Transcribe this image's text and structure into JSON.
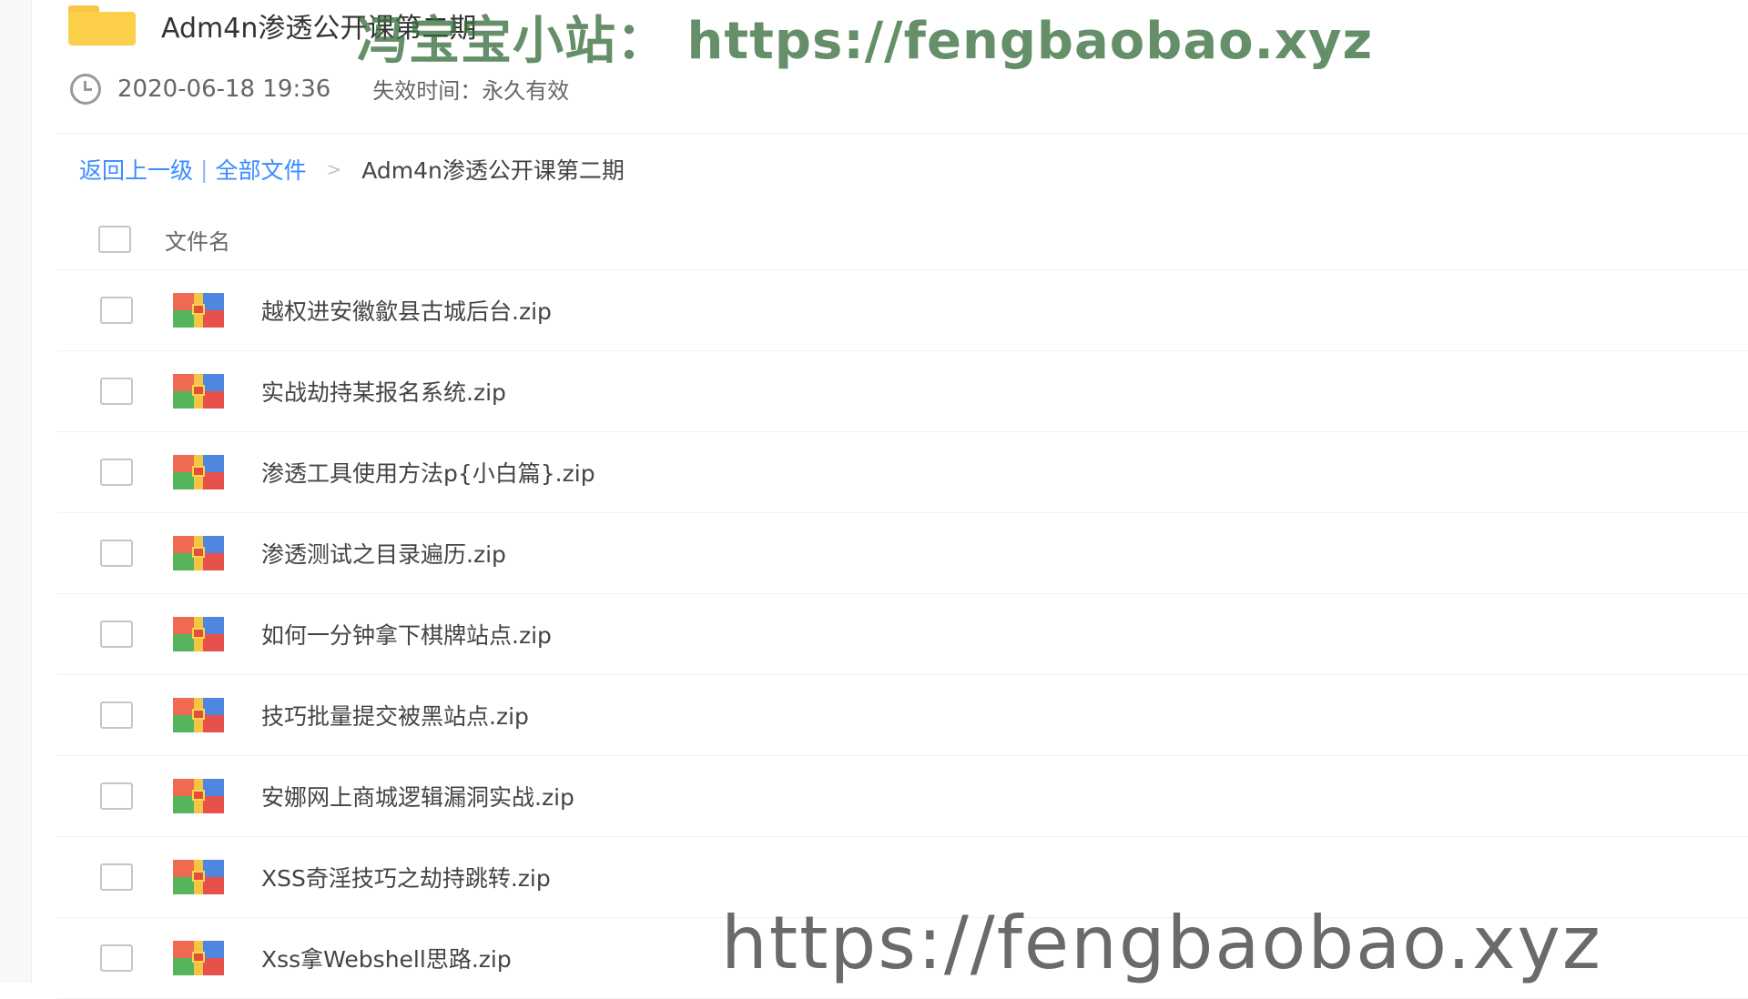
{
  "share": {
    "title": "Adm4n渗透公开课第二期",
    "date": "2020-06-18 19:36",
    "expire": "失效时间：永久有效"
  },
  "watermarks": {
    "top": "冯宝宝小站： https://fengbaobao.xyz",
    "bottom": "https://fengbaobao.xyz"
  },
  "breadcrumb": {
    "back": "返回上一级",
    "separator": "|",
    "all_files": "全部文件",
    "arrow": ">",
    "current": "Adm4n渗透公开课第二期"
  },
  "table": {
    "header": "文件名",
    "files": [
      {
        "name": "越权进安徽歙县古城后台.zip"
      },
      {
        "name": "实战劫持某报名系统.zip"
      },
      {
        "name": "渗透工具使用方法p{小白篇}.zip"
      },
      {
        "name": "渗透测试之目录遍历.zip"
      },
      {
        "name": "如何一分钟拿下棋牌站点.zip"
      },
      {
        "name": "技巧批量提交被黑站点.zip"
      },
      {
        "name": "安娜网上商城逻辑漏洞实战.zip"
      },
      {
        "name": "XSS奇淫技巧之劫持跳转.zip"
      },
      {
        "name": "Xss拿Webshell思路.zip"
      }
    ]
  },
  "icons": {
    "folder": "folder-icon",
    "clock": "clock-icon",
    "file": "zip-archive-icon"
  },
  "colors": {
    "link": "#3b8cff",
    "folder": "#fbcf4a",
    "watermark_top": "#38703e"
  }
}
